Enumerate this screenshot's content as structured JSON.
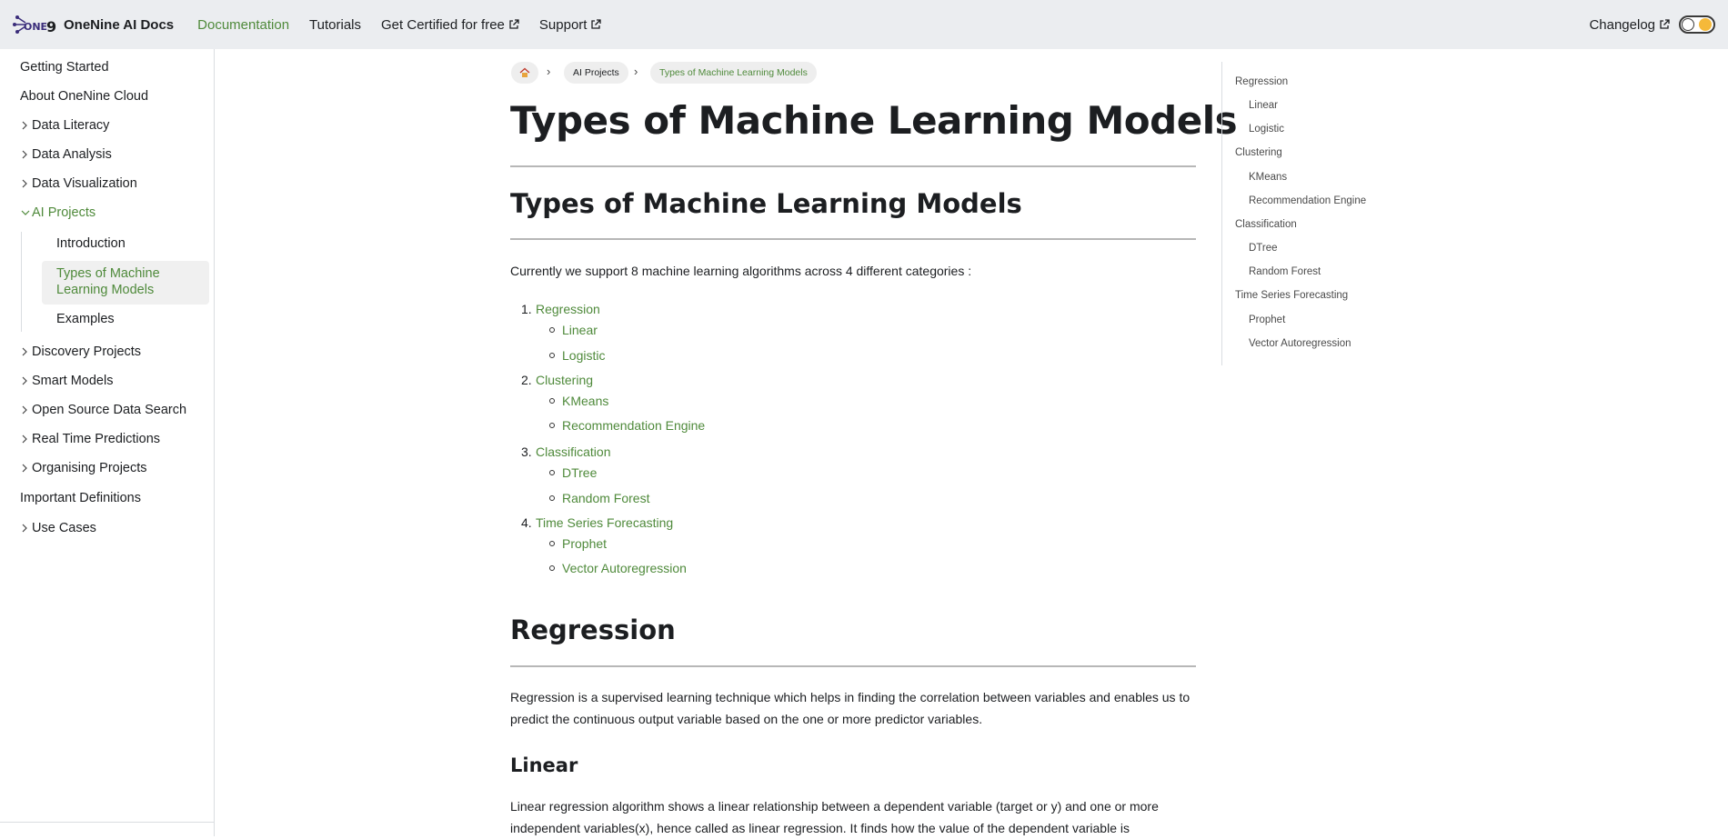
{
  "navbar": {
    "brand_logo_text": "ONE 9",
    "brand_title": "OneNine AI Docs",
    "links": [
      {
        "label": "Documentation"
      },
      {
        "label": "Tutorials"
      },
      {
        "label": "Get Certified for free"
      },
      {
        "label": "Support"
      }
    ],
    "changelog": "Changelog",
    "accent": "#4f8a3b"
  },
  "sidebar": {
    "items": [
      {
        "label": "Getting Started"
      },
      {
        "label": "About OneNine Cloud"
      },
      {
        "label": "Data Literacy"
      },
      {
        "label": "Data Analysis"
      },
      {
        "label": "Data Visualization"
      },
      {
        "label": "AI Projects"
      },
      {
        "label": "Discovery Projects"
      },
      {
        "label": "Smart Models"
      },
      {
        "label": "Open Source Data Search"
      },
      {
        "label": "Real Time Predictions"
      },
      {
        "label": "Organising Projects"
      },
      {
        "label": "Important Definitions"
      },
      {
        "label": "Use Cases"
      }
    ],
    "ai_projects_children": [
      {
        "label": "Introduction"
      },
      {
        "label": "Types of Machine Learning Models"
      },
      {
        "label": "Examples"
      }
    ]
  },
  "breadcrumb": {
    "home_icon": "home-icon",
    "items": [
      "AI Projects",
      "Types of Machine Learning Models"
    ]
  },
  "content": {
    "title": "Types of Machine Learning Models",
    "section_heading": "Types of Machine Learning Models",
    "intro": "Currently we support 8 machine learning algorithms across 4 different categories :",
    "categories": [
      {
        "num": "1.",
        "label": "Regression",
        "items": [
          "Linear",
          "Logistic"
        ]
      },
      {
        "num": "2.",
        "label": "Clustering",
        "items": [
          "KMeans",
          "Recommendation Engine"
        ]
      },
      {
        "num": "3.",
        "label": "Classification",
        "items": [
          "DTree",
          "Random Forest"
        ]
      },
      {
        "num": "4.",
        "label": "Time Series Forecasting",
        "items": [
          "Prophet",
          "Vector Autoregression"
        ]
      }
    ],
    "regression_heading": "Regression",
    "regression_text": "Regression is a supervised learning technique which helps in finding the correlation between variables and enables us to predict the continuous output variable based on the one or more predictor variables.",
    "linear_heading": "Linear",
    "linear_text": "Linear regression algorithm shows a linear relationship between a dependent variable (target or y) and one or more independent variables(x), hence called as linear regression. It finds how the value of the dependent variable is"
  },
  "toc": {
    "items": [
      {
        "label": "Regression",
        "level": 1
      },
      {
        "label": "Linear",
        "level": 2
      },
      {
        "label": "Logistic",
        "level": 2
      },
      {
        "label": "Clustering",
        "level": 1
      },
      {
        "label": "KMeans",
        "level": 2
      },
      {
        "label": "Recommendation Engine",
        "level": 2
      },
      {
        "label": "Classification",
        "level": 1
      },
      {
        "label": "DTree",
        "level": 2
      },
      {
        "label": "Random Forest",
        "level": 2
      },
      {
        "label": "Time Series Forecasting",
        "level": 1
      },
      {
        "label": "Prophet",
        "level": 2
      },
      {
        "label": "Vector Autoregression",
        "level": 2
      }
    ]
  }
}
